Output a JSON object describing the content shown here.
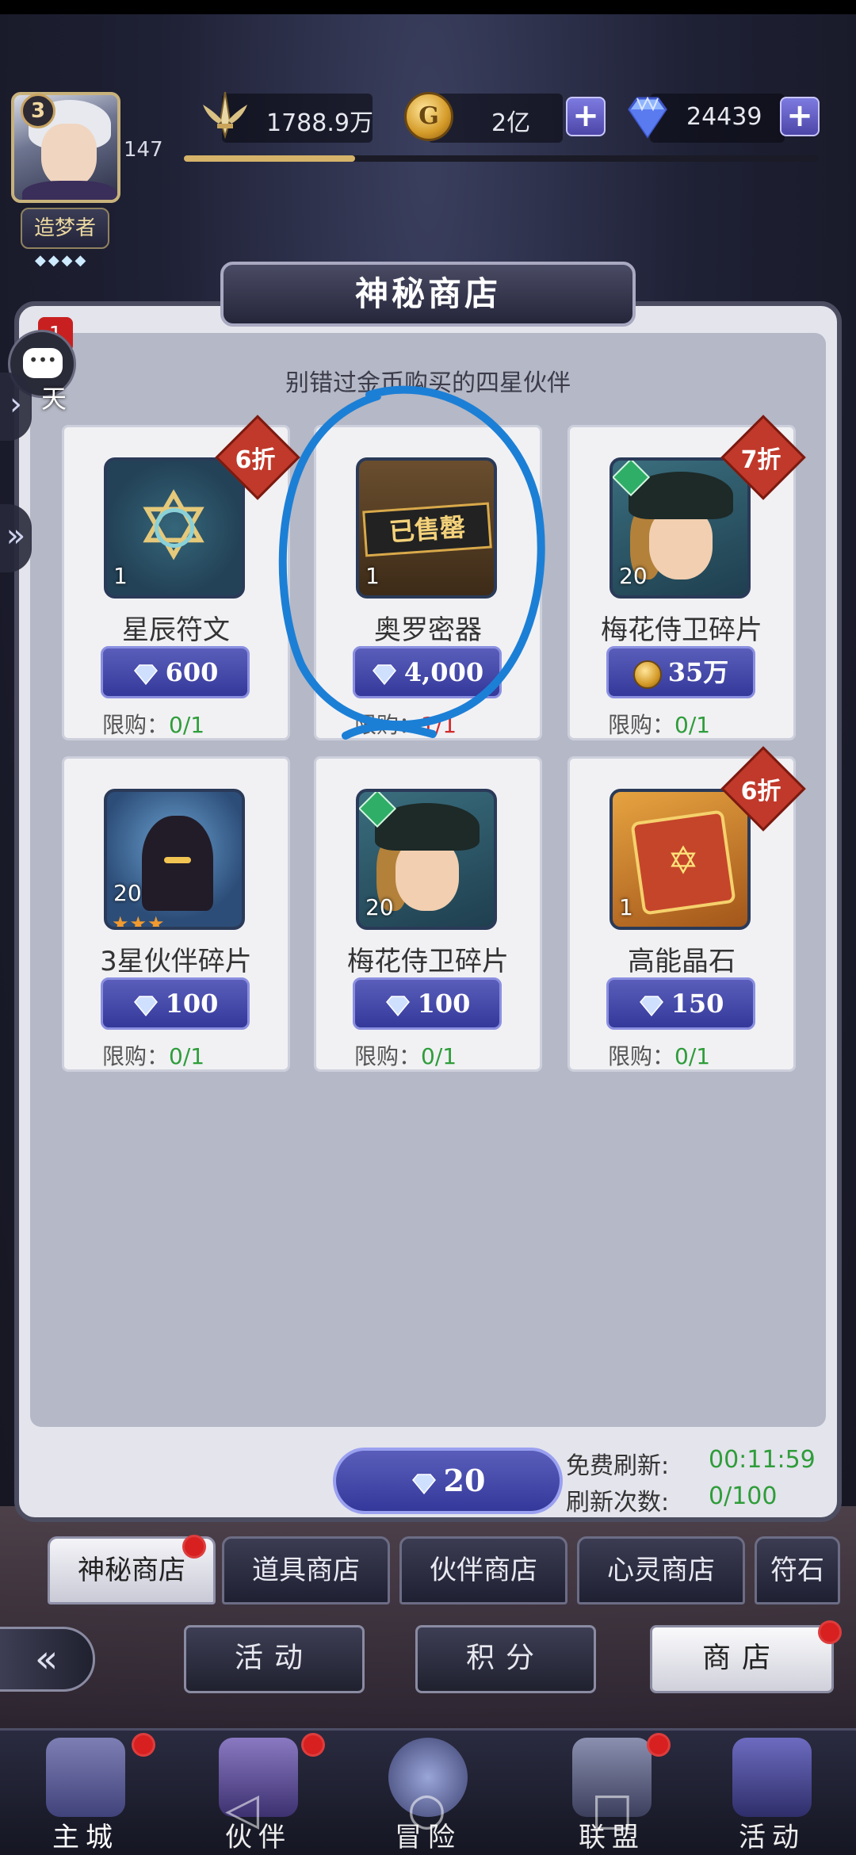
{
  "player": {
    "level_badge": "3",
    "level_value": "147",
    "rank_title": "造梦者",
    "rank_stars": "◆◆◆◆",
    "xp_fraction": 0.27
  },
  "resources": {
    "power": "1788.9万",
    "gold": "2亿",
    "diamonds": "24439",
    "icons": {
      "power": "sword-wings-icon",
      "gold": "gold-coin-icon",
      "diamonds": "diamond-icon"
    }
  },
  "shop": {
    "title": "神秘商店",
    "tagline": "别错过金币购买的四星伙伴",
    "items": [
      {
        "name": "星辰符文",
        "qty": "1",
        "price": "600",
        "currency": "diamond",
        "limit_label": "限购：",
        "limit": "0/1",
        "discount": "6折",
        "sold_out": false
      },
      {
        "name": "奥罗密器",
        "qty": "1",
        "price": "4,000",
        "currency": "diamond",
        "limit_label": "限购：",
        "limit": "1/1",
        "discount": "",
        "sold_out": true,
        "sold_out_label": "已售罄"
      },
      {
        "name": "梅花侍卫碎片",
        "qty": "20",
        "price": "35万",
        "currency": "gold",
        "limit_label": "限购：",
        "limit": "0/1",
        "discount": "7折",
        "sold_out": false
      },
      {
        "name": "3星伙伴碎片",
        "qty": "20",
        "price": "100",
        "currency": "diamond",
        "limit_label": "限购：",
        "limit": "0/1",
        "discount": "",
        "sold_out": false
      },
      {
        "name": "梅花侍卫碎片",
        "qty": "20",
        "price": "100",
        "currency": "diamond",
        "limit_label": "限购：",
        "limit": "0/1",
        "discount": "",
        "sold_out": false
      },
      {
        "name": "高能晶石",
        "qty": "1",
        "price": "150",
        "currency": "diamond",
        "limit_label": "限购：",
        "limit": "0/1",
        "discount": "6折",
        "sold_out": false
      }
    ],
    "refresh": {
      "cost": "20",
      "free_label": "免费刷新:",
      "free_timer": "00:11:59",
      "count_label": "刷新次数:",
      "count_value": "0/100"
    }
  },
  "shop_tabs": [
    "神秘商店",
    "道具商店",
    "伙伴商店",
    "心灵商店",
    "符石"
  ],
  "sub_nav": {
    "activity": "活动",
    "points": "积分",
    "shop": "商店"
  },
  "bottom_nav": [
    "主城",
    "伙伴",
    "冒险",
    "联盟",
    "活动"
  ],
  "chat": {
    "label": "天",
    "count": "1"
  },
  "colors": {
    "accent_blue": "#34389a",
    "limit_green": "#2f9d3a",
    "limit_red": "#d22a2a",
    "discount_red": "#c0392b",
    "annotation_blue": "#1c7fd6"
  }
}
